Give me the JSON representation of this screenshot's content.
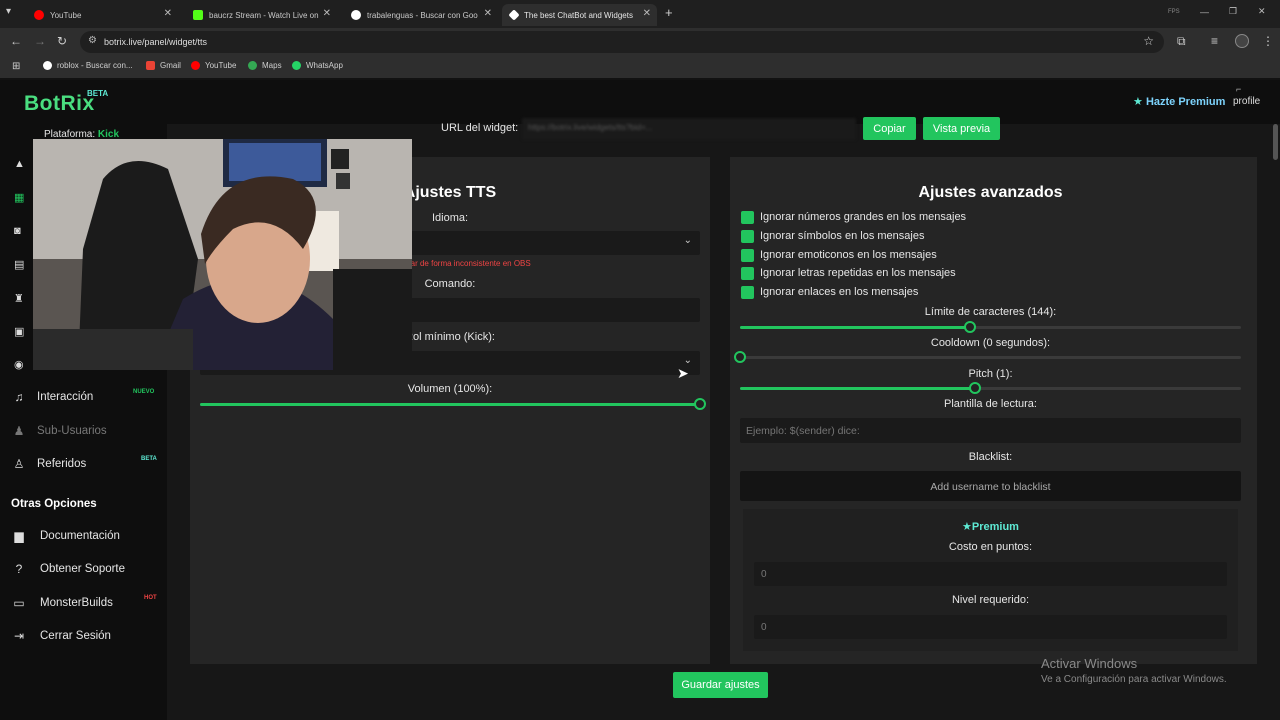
{
  "browser": {
    "tabs": [
      {
        "title": "YouTube",
        "color": "#ff0000"
      },
      {
        "title": "baucrz Stream - Watch Live on",
        "color": "#53fc18"
      },
      {
        "title": "trabalenguas - Buscar con Goo",
        "color": "#ffffff"
      },
      {
        "title": "The best ChatBot and Widgets",
        "color": "#ffffff"
      }
    ],
    "url": "botrix.live/panel/widget/tts",
    "bookmarks": [
      {
        "label": "roblox - Buscar con...",
        "color": "#ffffff"
      },
      {
        "label": "Gmail",
        "color": "#ea4335"
      },
      {
        "label": "YouTube",
        "color": "#ff0000"
      },
      {
        "label": "Maps",
        "color": "#34a853"
      },
      {
        "label": "WhatsApp",
        "color": "#25d366"
      }
    ],
    "fps_label": "FPS"
  },
  "header": {
    "logo": "BotRix",
    "logo_badge": "BETA",
    "premium": "Hazte Premium",
    "profile": "profile"
  },
  "sidebar": {
    "platform_label": "Plataforma:",
    "platform_value": "Kick",
    "items": [
      {
        "label": "Interacción",
        "icon": "music-icon",
        "badge": "NUEVO",
        "badge_color": "#22c55e"
      },
      {
        "label": "Sub-Usuarios",
        "icon": "users-icon",
        "dimmed": true
      },
      {
        "label": "Referidos",
        "icon": "referral-icon",
        "badge": "BETA",
        "badge_color": "#5eead4"
      }
    ],
    "other_title": "Otras Opciones",
    "other_items": [
      {
        "label": "Documentación",
        "icon": "docs-icon"
      },
      {
        "label": "Obtener Soporte",
        "icon": "help-icon"
      },
      {
        "label": "MonsterBuilds",
        "icon": "laptop-icon",
        "badge": "HOT",
        "badge_color": "#ef4444"
      },
      {
        "label": "Cerrar Sesión",
        "icon": "logout-icon"
      }
    ]
  },
  "widget": {
    "url_label": "URL del widget:",
    "url_value": "https://botrix.live/widgets/tts?bid=...",
    "copy_button": "Copiar",
    "preview_button": "Vista previa"
  },
  "tts": {
    "title": "Ajustes TTS",
    "language_label": "Idioma:",
    "warning": "den funcionar de forma inconsistente en OBS",
    "command_label": "Comando:",
    "role_label": "Rol mínimo (Kick):",
    "volume_label": "Volumen (100%):",
    "volume_value": 100
  },
  "advanced": {
    "title": "Ajustes avanzados",
    "options": [
      "Ignorar números grandes en los mensajes",
      "Ignorar símbolos en los mensajes",
      "Ignorar emoticonos en los mensajes",
      "Ignorar letras repetidas en los mensajes",
      "Ignorar enlaces en los mensajes"
    ],
    "char_limit_label": "Límite de caracteres (144):",
    "char_limit_fraction": 0.46,
    "cooldown_label": "Cooldown (0 segundos):",
    "cooldown_fraction": 0,
    "pitch_label": "Pitch (1):",
    "pitch_fraction": 0.47,
    "template_label": "Plantilla de lectura:",
    "template_placeholder": "Ejemplo: $(sender) dice:",
    "blacklist_label": "Blacklist:",
    "blacklist_placeholder": "Add username to blacklist",
    "premium_title": "Premium",
    "points_label": "Costo en puntos:",
    "points_value": "0",
    "level_label": "Nivel requerido:",
    "level_value": "0"
  },
  "save_button": "Guardar ajustes",
  "watermark": {
    "title": "Activar Windows",
    "subtitle": "Ve a Configuración para activar Windows."
  },
  "colors": {
    "accent": "#22c55e",
    "premium": "#5eead4",
    "warning": "#ef4444"
  }
}
